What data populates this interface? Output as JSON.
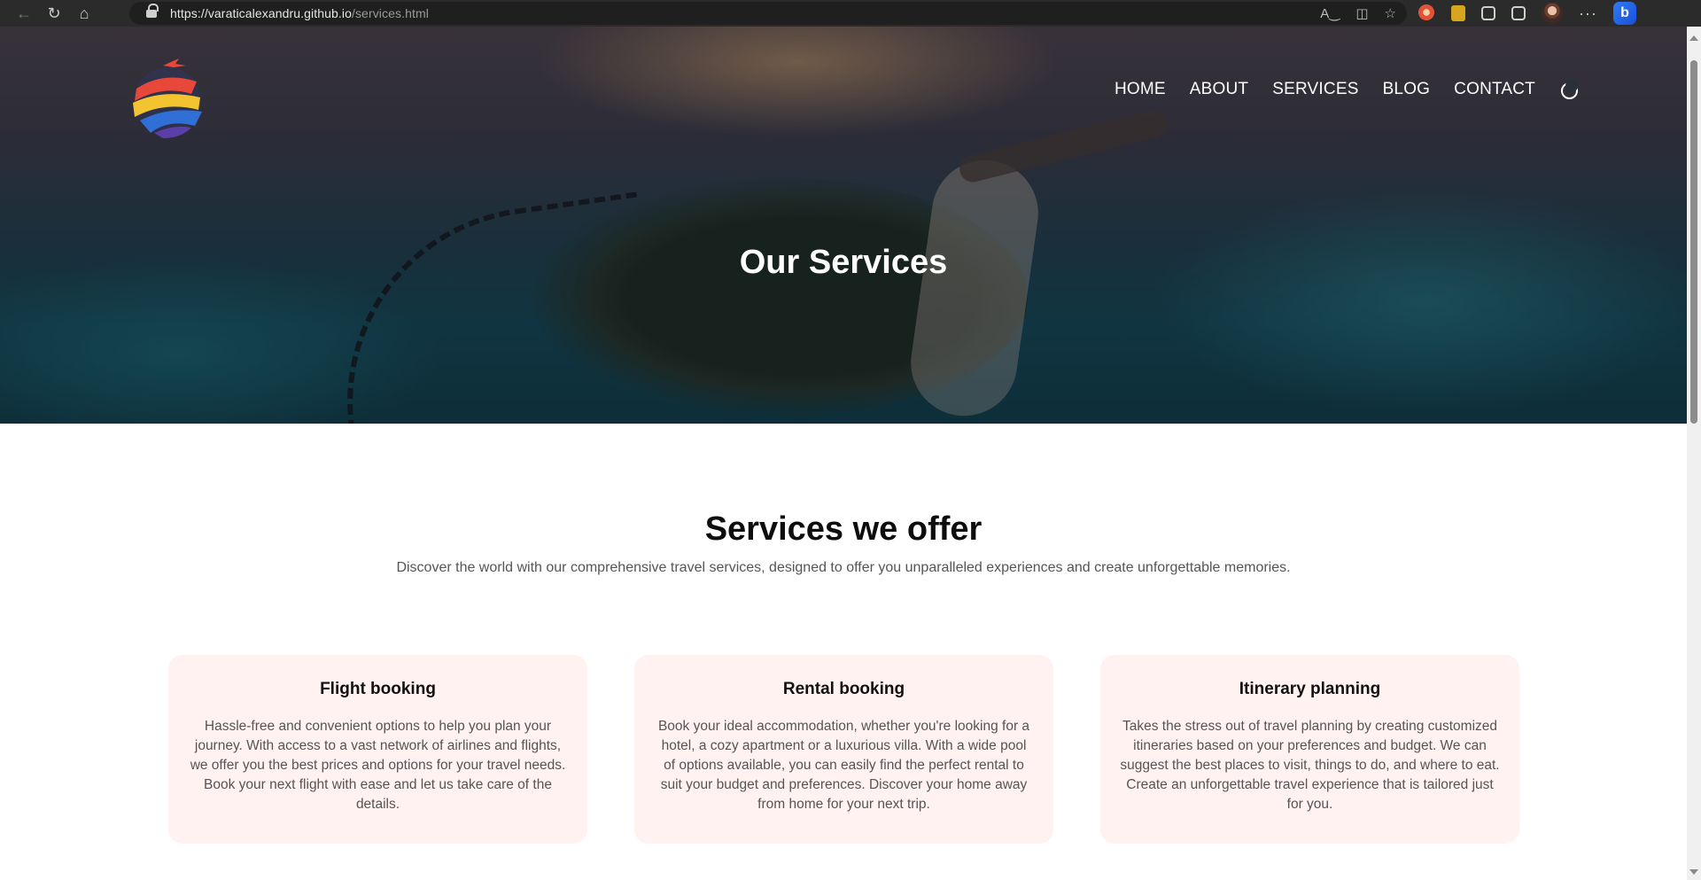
{
  "browser": {
    "url_host": "https://varaticalexandru.github.io",
    "url_path": "/services.html"
  },
  "nav": {
    "items": [
      "HOME",
      "ABOUT",
      "SERVICES",
      "BLOG",
      "CONTACT"
    ],
    "theme_toggle_icon": "moon-icon"
  },
  "hero": {
    "title": "Our Services"
  },
  "services": {
    "title": "Services we offer",
    "subtitle": "Discover the world with our comprehensive travel services, designed to offer you unparalleled experiences and create unforgettable memories.",
    "cards": [
      {
        "title": "Flight booking",
        "text": "Hassle-free and convenient options to help you plan your journey. With access to a vast network of airlines and flights, we offer you the best prices and options for your travel needs. Book your next flight with ease and let us take care of the details."
      },
      {
        "title": "Rental booking",
        "text": "Book your ideal accommodation, whether you're looking for a hotel, a cozy apartment or a luxurious villa. With a wide pool of options available, you can easily find the perfect rental to suit your budget and preferences. Discover your home away from home for your next trip."
      },
      {
        "title": "Itinerary planning",
        "text": "Takes the stress out of travel planning by creating customized itineraries based on your preferences and budget. We can suggest the best places to visit, things to do, and where to eat. Create an unforgettable travel experience that is tailored just for you."
      }
    ]
  },
  "colors": {
    "card_background": "#fff2f1",
    "browser_bar": "#2b2b2b"
  }
}
